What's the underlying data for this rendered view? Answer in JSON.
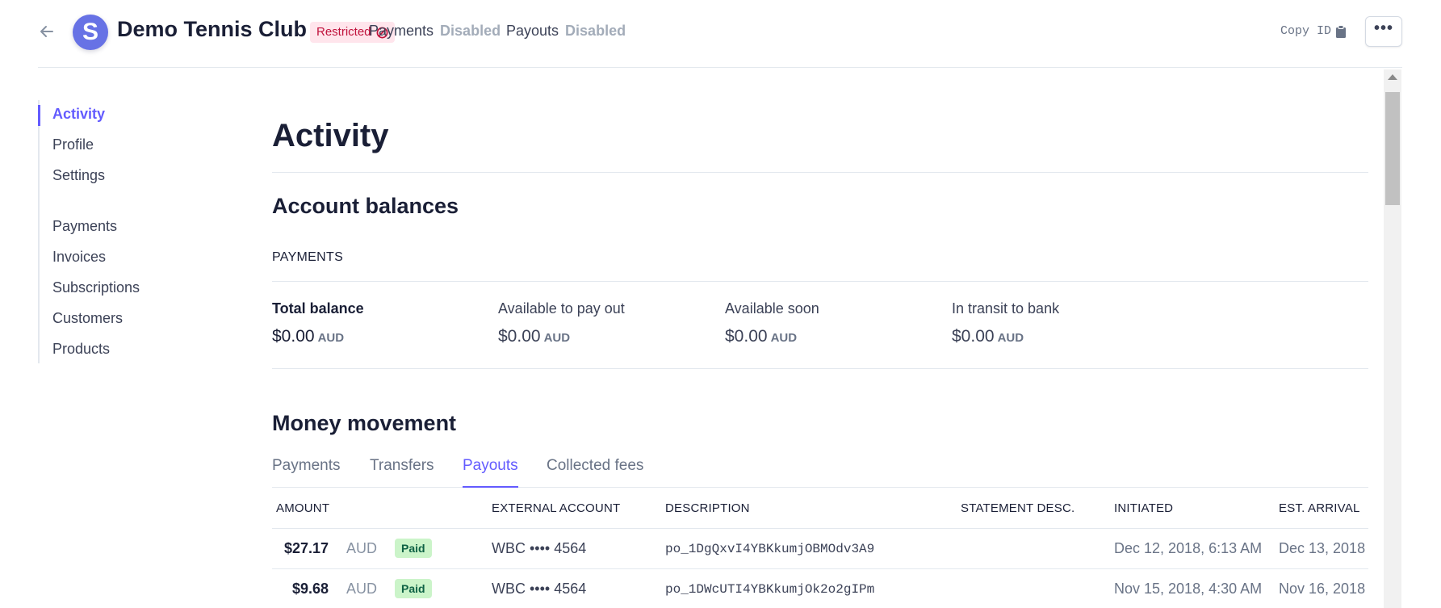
{
  "header": {
    "title": "Demo Tennis Club",
    "logo_letter": "S",
    "restricted_label": "Restricted",
    "payments_label": "Payments",
    "payments_status": "Disabled",
    "payouts_label": "Payouts",
    "payouts_status": "Disabled",
    "copy_id_label": "Copy ID",
    "more_label": "•••"
  },
  "sidebar": {
    "items": [
      {
        "label": "Activity"
      },
      {
        "label": "Profile"
      },
      {
        "label": "Settings"
      },
      {
        "label": "Payments"
      },
      {
        "label": "Invoices"
      },
      {
        "label": "Subscriptions"
      },
      {
        "label": "Customers"
      },
      {
        "label": "Products"
      }
    ]
  },
  "main": {
    "title": "Activity",
    "balances_heading": "Account balances",
    "payments_caption": "PAYMENTS",
    "balances": [
      {
        "label": "Total balance",
        "amount": "$0.00",
        "currency": "AUD"
      },
      {
        "label": "Available to pay out",
        "amount": "$0.00",
        "currency": "AUD"
      },
      {
        "label": "Available soon",
        "amount": "$0.00",
        "currency": "AUD"
      },
      {
        "label": "In transit to bank",
        "amount": "$0.00",
        "currency": "AUD"
      }
    ],
    "money_heading": "Money movement",
    "tabs": [
      {
        "label": "Payments"
      },
      {
        "label": "Transfers"
      },
      {
        "label": "Payouts"
      },
      {
        "label": "Collected fees"
      }
    ],
    "table": {
      "headers": [
        "AMOUNT",
        "EXTERNAL ACCOUNT",
        "DESCRIPTION",
        "STATEMENT DESC.",
        "INITIATED",
        "EST. ARRIVAL"
      ],
      "rows": [
        {
          "amount": "$27.17",
          "currency": "AUD",
          "status": "Paid",
          "account": "WBC •••• 4564",
          "description": "po_1DgQxvI4YBKkumjOBMOdv3A9",
          "statement": "",
          "initiated": "Dec 12, 2018, 6:13 AM",
          "arrival": "Dec 13, 2018"
        },
        {
          "amount": "$9.68",
          "currency": "AUD",
          "status": "Paid",
          "account": "WBC •••• 4564",
          "description": "po_1DWcUTI4YBKkumjOk2o2gIPm",
          "statement": "",
          "initiated": "Nov 15, 2018, 4:30 AM",
          "arrival": "Nov 16, 2018"
        }
      ]
    }
  },
  "colors": {
    "accent": "#635bff",
    "brand": "#6772e5",
    "restricted_bg": "#ffe5ec",
    "restricted_fg": "#c0123c",
    "paid_bg": "#cbf4c9",
    "paid_fg": "#0e6245"
  }
}
